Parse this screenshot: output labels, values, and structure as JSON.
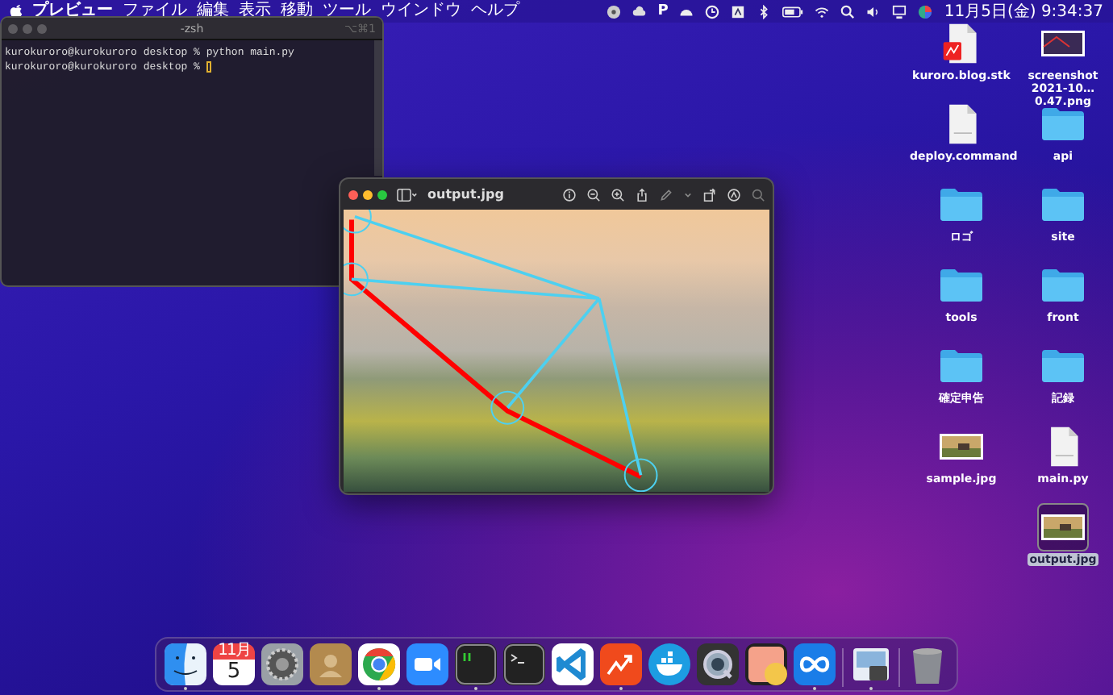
{
  "menu_bar": {
    "app_name": "プレビュー",
    "menus": [
      "ファイル",
      "編集",
      "表示",
      "移動",
      "ツール",
      "ウインドウ",
      "ヘルプ"
    ],
    "status_text": "P",
    "clock": "11月5日(金) 9:34:37"
  },
  "terminal": {
    "title": "-zsh",
    "shortcut": "⌥⌘1",
    "lines": [
      "kurokuroro@kurokuroro desktop % python main.py",
      "kurokuroro@kurokuroro desktop % "
    ]
  },
  "preview": {
    "title": "output.jpg"
  },
  "desktop_icons": [
    {
      "label": "kuroro.blog.stk",
      "kind": "stk",
      "selected": false
    },
    {
      "label": "screenshot 2021-10…0.47.png",
      "kind": "screenshot",
      "selected": false
    },
    {
      "label": "deploy.command",
      "kind": "shell",
      "selected": false
    },
    {
      "label": "api",
      "kind": "folder",
      "selected": false
    },
    {
      "label": "ロゴ",
      "kind": "folder",
      "selected": false
    },
    {
      "label": "site",
      "kind": "folder",
      "selected": false
    },
    {
      "label": "tools",
      "kind": "folder",
      "selected": false
    },
    {
      "label": "front",
      "kind": "folder",
      "selected": false
    },
    {
      "label": "確定申告",
      "kind": "folder",
      "selected": false
    },
    {
      "label": "記録",
      "kind": "folder",
      "selected": false
    },
    {
      "label": "sample.jpg",
      "kind": "photo",
      "selected": false
    },
    {
      "label": "main.py",
      "kind": "python",
      "selected": false
    },
    {
      "label": "output.jpg",
      "kind": "photo",
      "selected": true
    }
  ],
  "dock": [
    {
      "kind": "finder",
      "running": true
    },
    {
      "kind": "calendar",
      "month": "11月",
      "day": "5",
      "running": false
    },
    {
      "kind": "settings",
      "running": false
    },
    {
      "kind": "contacts",
      "running": false
    },
    {
      "kind": "chrome",
      "running": true
    },
    {
      "kind": "zoom",
      "running": false
    },
    {
      "kind": "iterm",
      "running": true
    },
    {
      "kind": "terminal",
      "running": false
    },
    {
      "kind": "vscode",
      "running": false
    },
    {
      "kind": "stk",
      "running": true
    },
    {
      "kind": "docker",
      "running": false
    },
    {
      "kind": "quicktime",
      "running": false
    },
    {
      "kind": "preview-app",
      "running": false
    },
    {
      "kind": "infinity",
      "running": true
    },
    {
      "kind": "separator"
    },
    {
      "kind": "photos-doc",
      "running": true
    },
    {
      "kind": "separator"
    },
    {
      "kind": "trash",
      "running": false
    }
  ]
}
